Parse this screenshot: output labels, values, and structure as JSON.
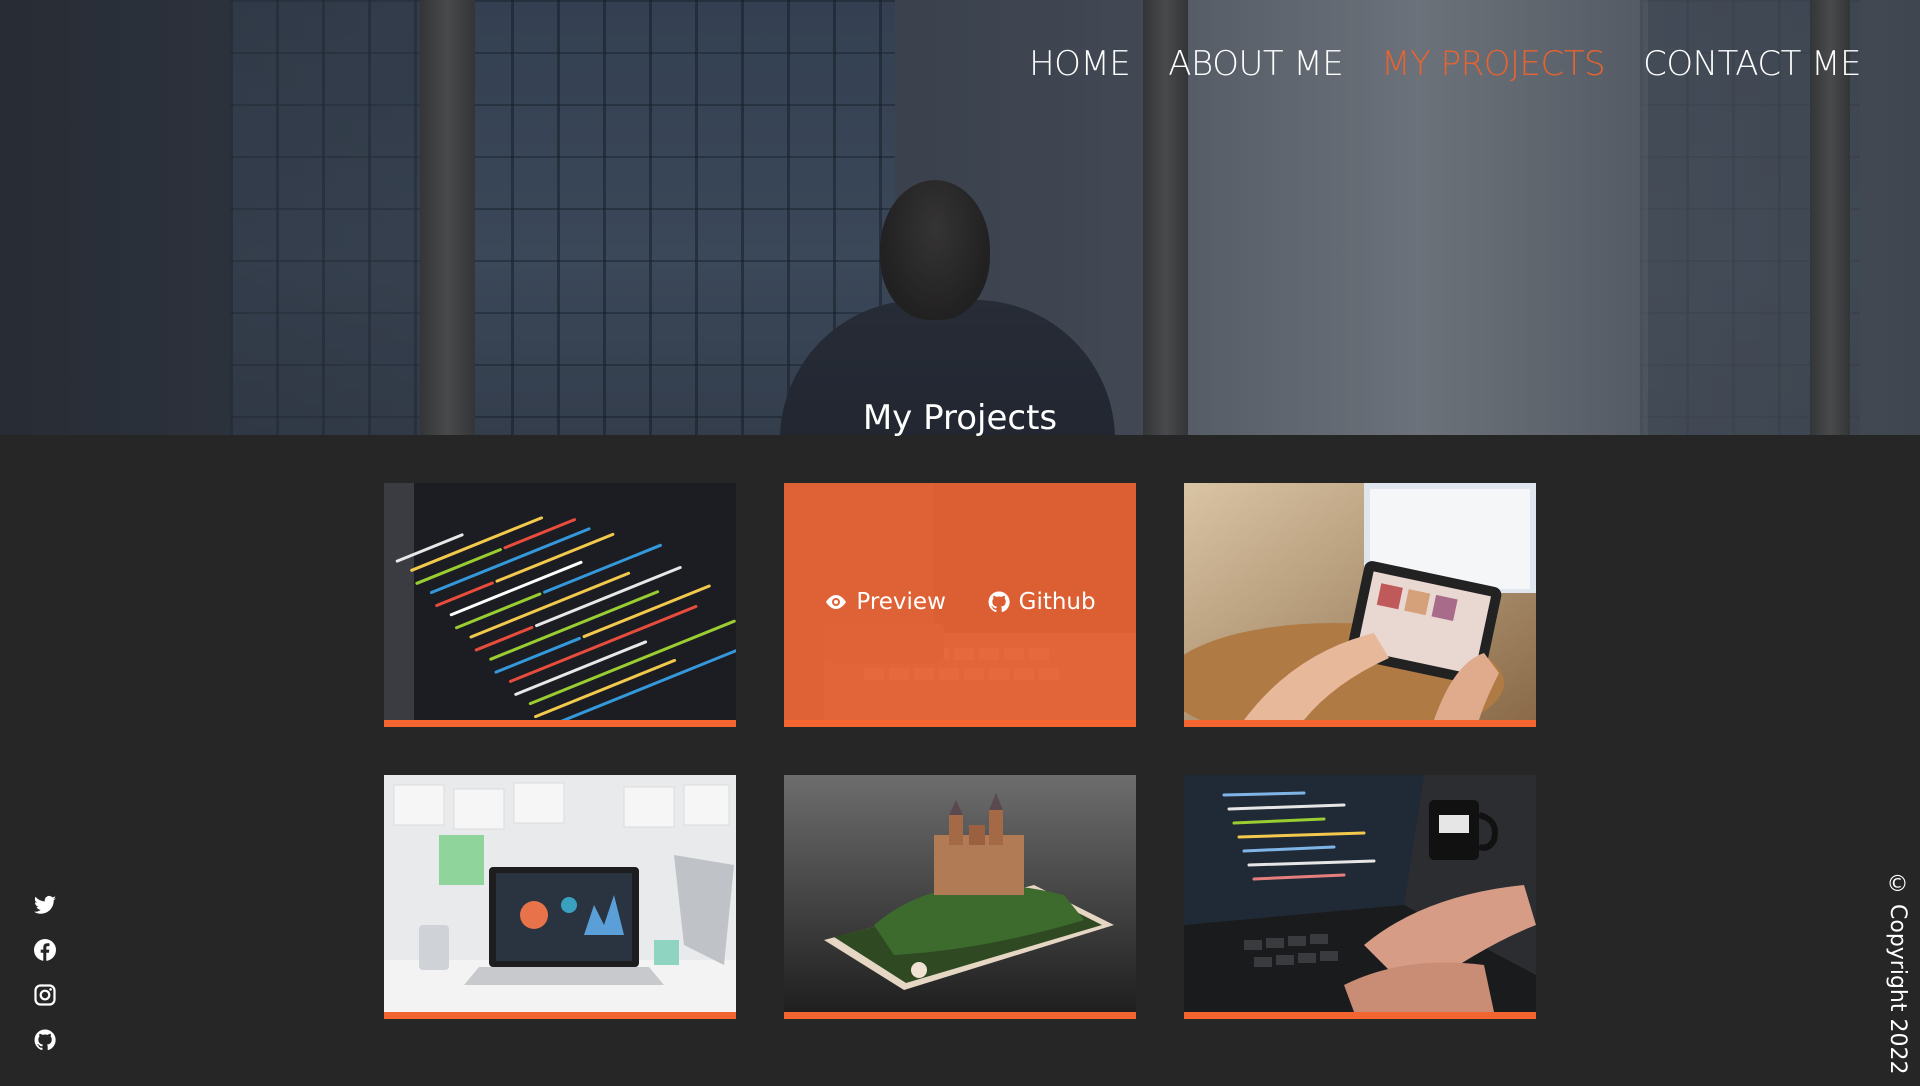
{
  "nav": {
    "items": [
      {
        "label": "HOME",
        "active": false
      },
      {
        "label": "ABOUT ME",
        "active": false
      },
      {
        "label": "MY PROJECTS",
        "active": true
      },
      {
        "label": "CONTACT ME",
        "active": false
      }
    ]
  },
  "hero": {
    "title": "My Projects"
  },
  "projects": {
    "overlay": {
      "preview_label": "Preview",
      "github_label": "Github"
    },
    "cards": [
      {
        "image": "code-editor-screen",
        "hovered": false
      },
      {
        "image": "laptop-keyboard",
        "hovered": true
      },
      {
        "image": "tablet-shopping",
        "hovered": false
      },
      {
        "image": "laptop-dashboard-desk",
        "hovered": false
      },
      {
        "image": "phone-castle",
        "hovered": false
      },
      {
        "image": "laptop-coding-mug",
        "hovered": false
      }
    ]
  },
  "social": {
    "icons": [
      "twitter-icon",
      "facebook-icon",
      "instagram-icon",
      "github-icon"
    ]
  },
  "footer": {
    "copyright": "© Copyright 2022"
  },
  "colors": {
    "accent": "#f26430",
    "background": "#262626",
    "text": "#ffffff"
  }
}
